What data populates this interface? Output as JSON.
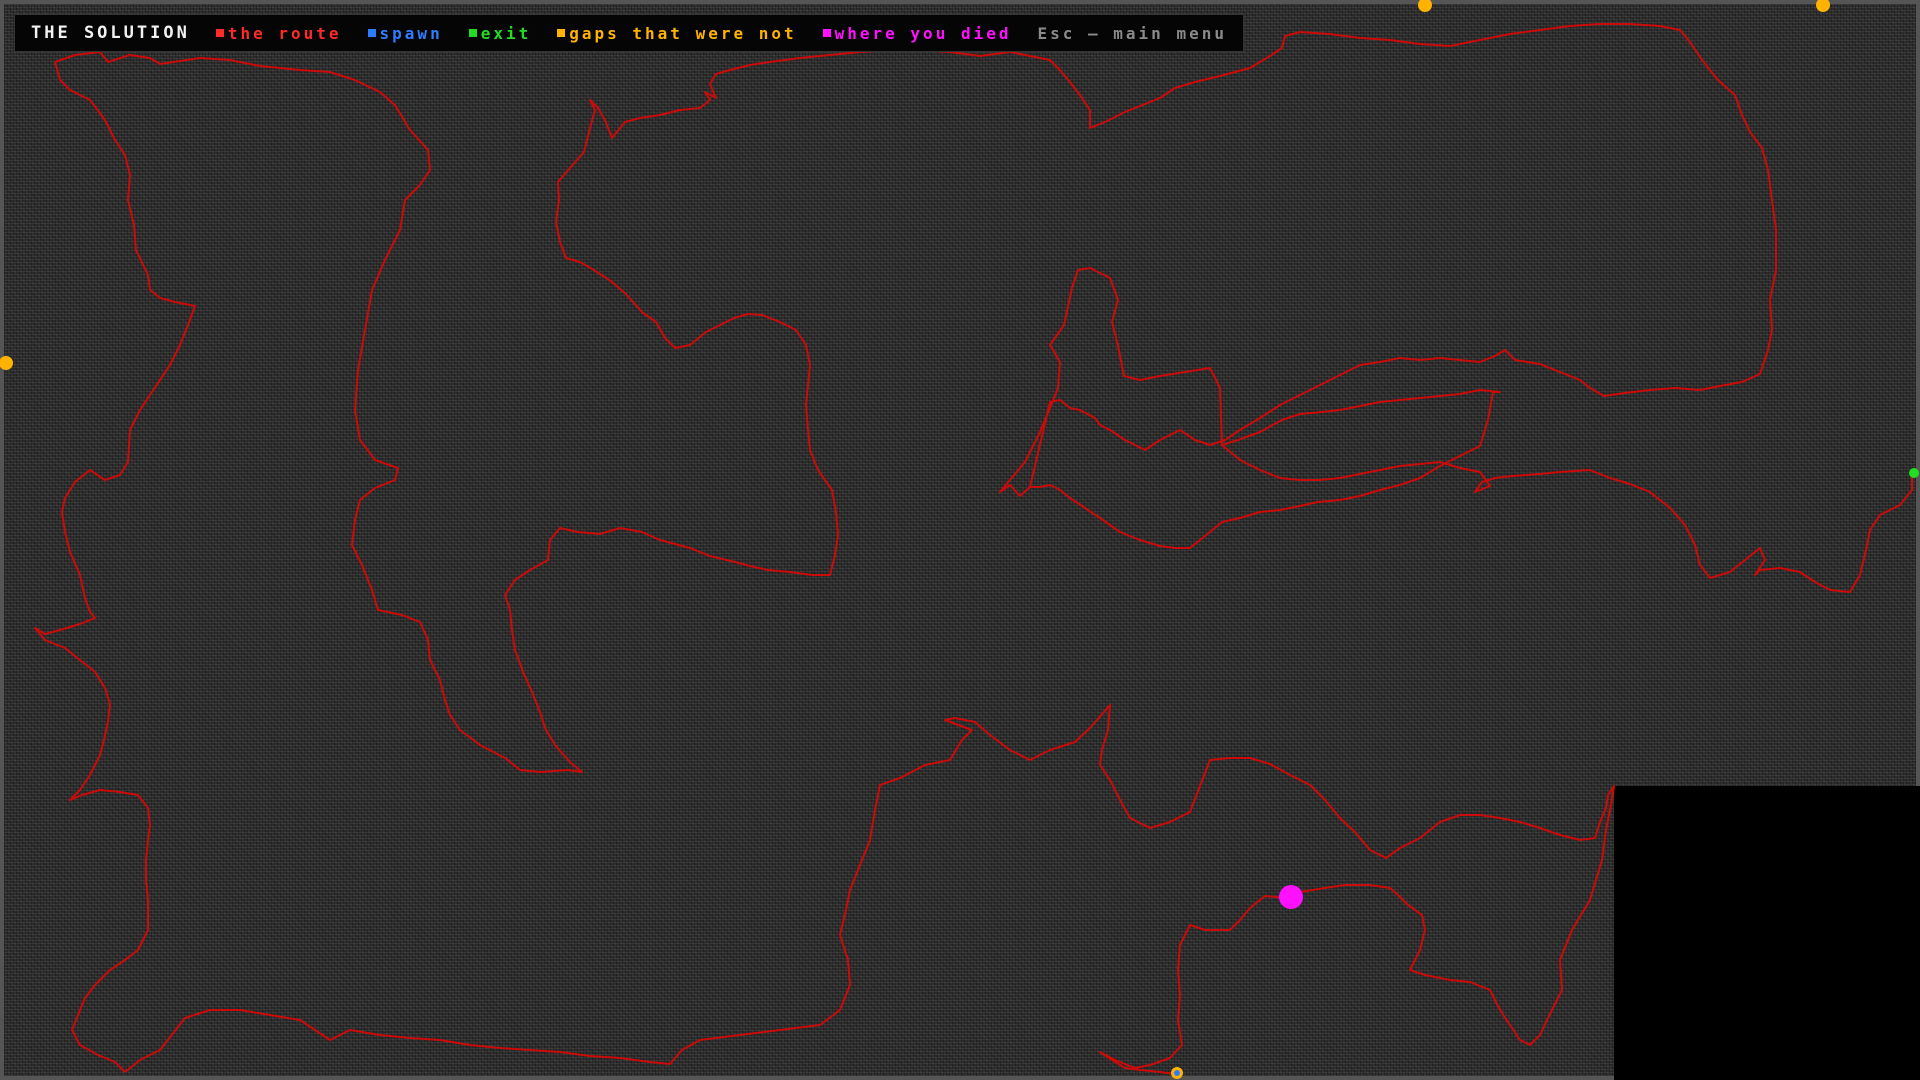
{
  "legend": {
    "title": "THE SOLUTION",
    "items": [
      {
        "key": "route",
        "label": "the route",
        "color": "#ff2a2a"
      },
      {
        "key": "spawn",
        "label": "spawn",
        "color": "#2f7dff"
      },
      {
        "key": "exit",
        "label": "exit",
        "color": "#22dd22"
      },
      {
        "key": "gaps",
        "label": "gaps that were not",
        "color": "#ffb300"
      },
      {
        "key": "death",
        "label": "where you died",
        "color": "#ff10ff"
      }
    ],
    "hint": "Esc — main menu"
  },
  "colors": {
    "route": "#cc0a0a",
    "spawn": "#2f7dff",
    "exit": "#22dd22",
    "gap": "#ffb300",
    "death": "#ff10ff",
    "maze_bg": "#2a2a2a",
    "frame": "#555555"
  }
}
